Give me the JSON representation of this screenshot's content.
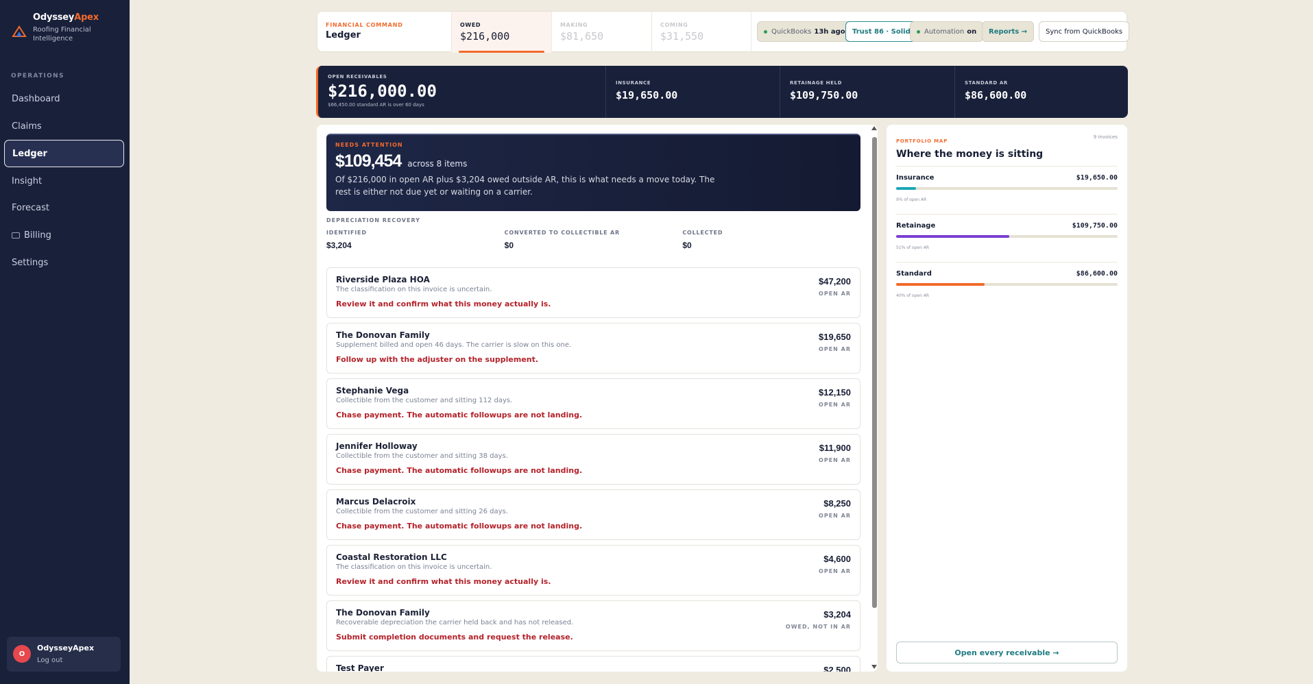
{
  "brand": {
    "name_a": "Odyssey",
    "name_b": "Apex",
    "subtitle": "Roofing Financial Intelligence"
  },
  "sidebar": {
    "section": "OPERATIONS",
    "items": [
      {
        "label": "Dashboard",
        "active": false
      },
      {
        "label": "Claims",
        "active": false
      },
      {
        "label": "Ledger",
        "active": true
      },
      {
        "label": "Insight",
        "active": false
      },
      {
        "label": "Forecast",
        "active": false
      },
      {
        "label": "Billing",
        "active": false,
        "icon": "card-icon"
      },
      {
        "label": "Settings",
        "active": false
      }
    ],
    "user": {
      "initial": "O",
      "name": "OdysseyApex",
      "logout": "Log out"
    }
  },
  "topbar": {
    "kicker": "FINANCIAL COMMAND",
    "title": "Ledger",
    "tabs": [
      {
        "label": "OWED",
        "value": "$216,000"
      },
      {
        "label": "MAKING",
        "value": "$81,650"
      },
      {
        "label": "COMING",
        "value": "$31,550"
      }
    ],
    "quickbooks": {
      "label": "QuickBooks",
      "value": "13h ago"
    },
    "trust": "Trust 86 · Solid",
    "automation": {
      "label": "Automation",
      "value": "on"
    },
    "reports": "Reports →",
    "sync": "Sync from QuickBooks"
  },
  "ar_summary": {
    "open": {
      "label": "OPEN RECEIVABLES",
      "value": "$216,000.00",
      "note": "$66,450.00 standard AR is over 60 days"
    },
    "insurance": {
      "label": "INSURANCE",
      "value": "$19,650.00"
    },
    "retainage": {
      "label": "RETAINAGE HELD",
      "value": "$109,750.00"
    },
    "standard": {
      "label": "STANDARD AR",
      "value": "$86,600.00"
    }
  },
  "needs_attention": {
    "kicker": "NEEDS ATTENTION",
    "amount": "$109,454",
    "across": "across 8 items",
    "description": "Of $216,000 in open AR plus $3,204 owed outside AR, this is what needs a move today. The rest is either not due yet or waiting on a carrier."
  },
  "depreciation": {
    "title": "DEPRECIATION RECOVERY",
    "cols": [
      {
        "label": "IDENTIFIED",
        "value": "$3,204"
      },
      {
        "label": "CONVERTED TO COLLECTIBLE AR",
        "value": "$0"
      },
      {
        "label": "COLLECTED",
        "value": "$0"
      }
    ]
  },
  "items": [
    {
      "name": "Riverside Plaza HOA",
      "desc": "The classification on this invoice is uncertain.",
      "action": "Review it and confirm what this money actually is.",
      "amount": "$47,200",
      "status": "OPEN AR"
    },
    {
      "name": "The Donovan Family",
      "desc": "Supplement billed and open 46 days. The carrier is slow on this one.",
      "action": "Follow up with the adjuster on the supplement.",
      "amount": "$19,650",
      "status": "OPEN AR"
    },
    {
      "name": "Stephanie Vega",
      "desc": "Collectible from the customer and sitting 112 days.",
      "action": "Chase payment. The automatic followups are not landing.",
      "amount": "$12,150",
      "status": "OPEN AR"
    },
    {
      "name": "Jennifer Holloway",
      "desc": "Collectible from the customer and sitting 38 days.",
      "action": "Chase payment. The automatic followups are not landing.",
      "amount": "$11,900",
      "status": "OPEN AR"
    },
    {
      "name": "Marcus Delacroix",
      "desc": "Collectible from the customer and sitting 26 days.",
      "action": "Chase payment. The automatic followups are not landing.",
      "amount": "$8,250",
      "status": "OPEN AR"
    },
    {
      "name": "Coastal Restoration LLC",
      "desc": "The classification on this invoice is uncertain.",
      "action": "Review it and confirm what this money actually is.",
      "amount": "$4,600",
      "status": "OPEN AR"
    },
    {
      "name": "The Donovan Family",
      "desc": "Recoverable depreciation the carrier held back and has not released.",
      "action": "Submit completion documents and request the release.",
      "amount": "$3,204",
      "status": "OWED, NOT IN AR"
    },
    {
      "name": "Test Payer",
      "desc": "",
      "action": "",
      "amount": "$2,500",
      "status": ""
    }
  ],
  "portfolio": {
    "kicker": "PORTFOLIO MAP",
    "count": "9 invoices",
    "title": "Where the money is sitting",
    "rows": [
      {
        "name": "Insurance",
        "value": "$19,650.00",
        "pct_text": "9% of open AR",
        "share": 0.09,
        "color": "#1aa7b5"
      },
      {
        "name": "Retainage",
        "value": "$109,750.00",
        "pct_text": "51% of open AR",
        "share": 0.51,
        "color": "#7a3fd1"
      },
      {
        "name": "Standard",
        "value": "$86,600.00",
        "pct_text": "40% of open AR",
        "share": 0.4,
        "color": "#f26a2c"
      }
    ],
    "button": "Open every receivable →"
  }
}
